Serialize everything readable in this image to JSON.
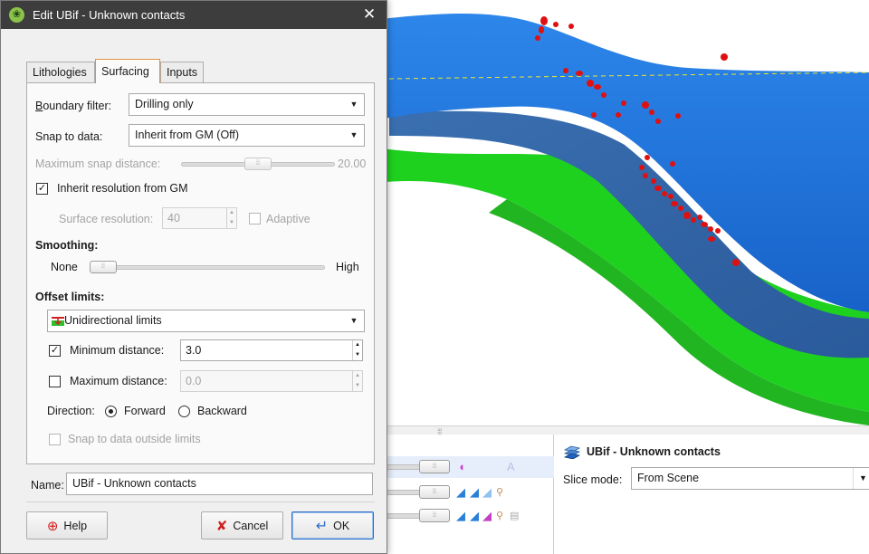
{
  "dialog": {
    "title": "Edit UBif - Unknown contacts",
    "tabs": [
      {
        "label": "Lithologies",
        "active": false
      },
      {
        "label": "Surfacing",
        "active": true
      },
      {
        "label": "Inputs",
        "active": false
      }
    ],
    "boundary_filter": {
      "label": "Boundary filter:",
      "value": "Drilling only"
    },
    "snap_to_data": {
      "label": "Snap to data:",
      "value": "Inherit from GM (Off)"
    },
    "max_snap_distance": {
      "label": "Maximum snap distance:",
      "value": "20.00",
      "enabled": false
    },
    "inherit_resolution": {
      "label": "Inherit resolution from GM",
      "checked": true
    },
    "surface_resolution": {
      "label": "Surface resolution:",
      "value": "40",
      "enabled": false
    },
    "adaptive": {
      "label": "Adaptive",
      "checked": false,
      "enabled": false
    },
    "smoothing": {
      "heading": "Smoothing:",
      "min_label": "None",
      "max_label": "High",
      "level": 0.0
    },
    "offset_limits": {
      "heading": "Offset limits:",
      "mode": "Unidirectional limits",
      "minimum_distance": {
        "label": "Minimum distance:",
        "checked": true,
        "value": "3.0"
      },
      "maximum_distance": {
        "label": "Maximum distance:",
        "checked": false,
        "value": "0.0"
      },
      "direction": {
        "label": "Direction:",
        "forward": "Forward",
        "backward": "Backward",
        "selected": "Forward"
      },
      "snap_outside": {
        "label": "Snap to data outside limits",
        "checked": false,
        "enabled": false
      }
    },
    "name": {
      "label": "Name:",
      "value": "UBif - Unknown contacts"
    },
    "buttons": {
      "help": "Help",
      "cancel": "Cancel",
      "ok": "OK"
    }
  },
  "properties": {
    "title": "UBif - Unknown contacts",
    "slice_mode_label": "Slice mode:",
    "slice_mode_value": "From Scene"
  },
  "colors": {
    "surface_blue": "#1f78e0",
    "surface_green": "#1fd11f",
    "contact_points": "#e01010",
    "dialog_bg": "#f0f0f0",
    "titlebar": "#3d3d3d",
    "active_tab_border": "#e5913c"
  }
}
